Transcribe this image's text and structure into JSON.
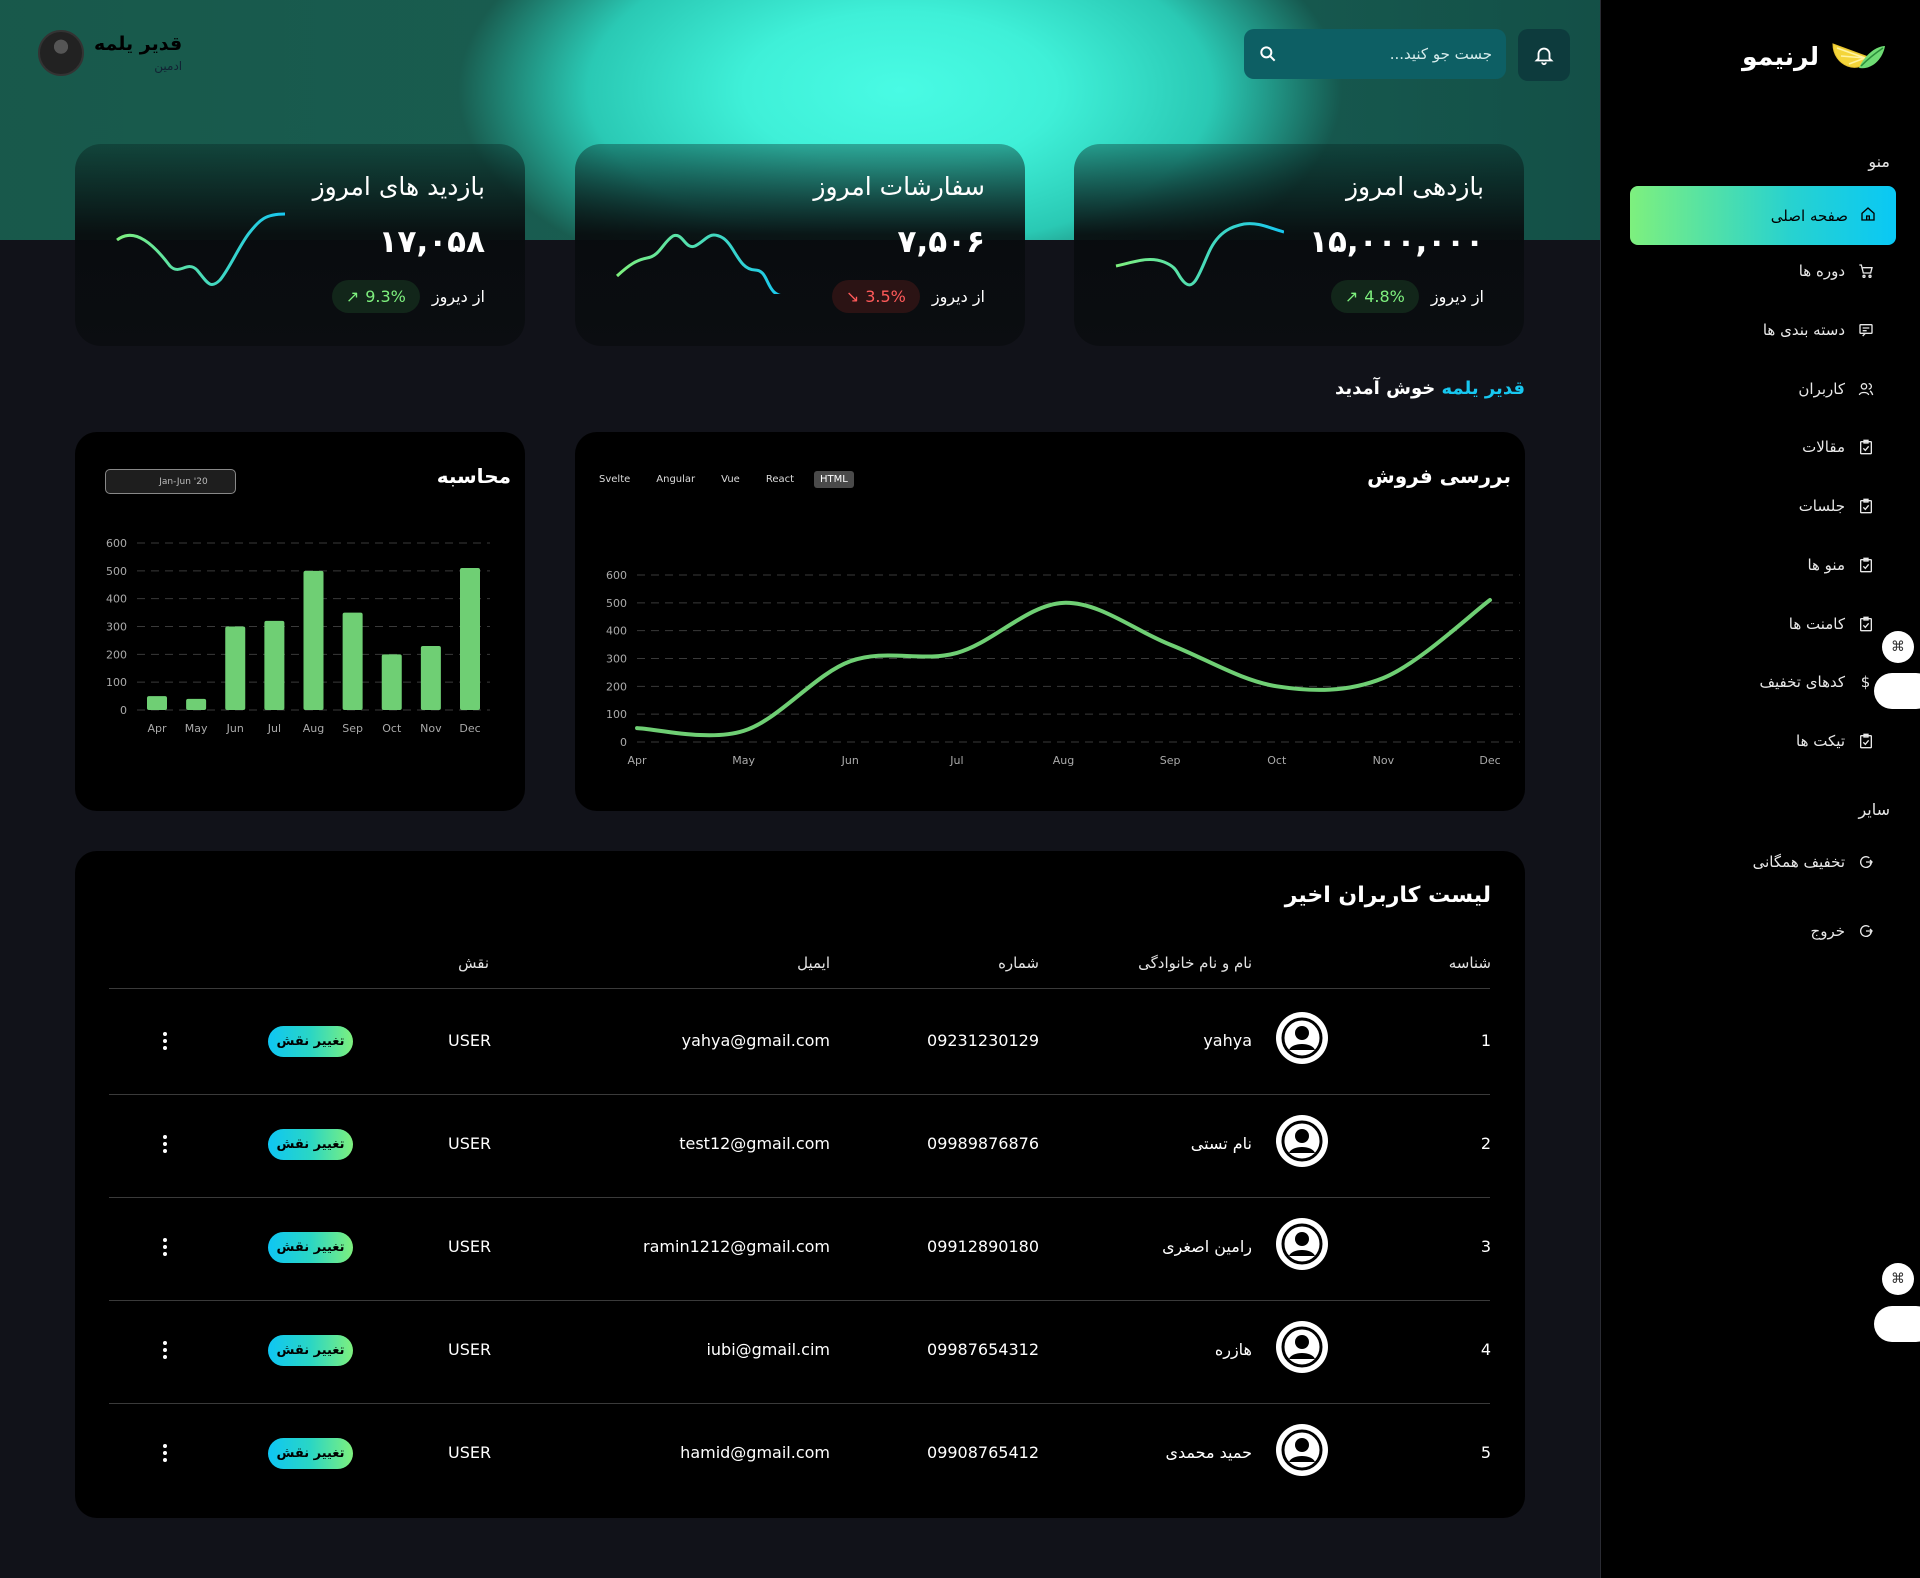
{
  "brand": {
    "name": "لرنیمو"
  },
  "sidebar": {
    "menu_label": "منو",
    "other_label": "سایر",
    "items": [
      {
        "label": "صفحه اصلی",
        "icon": "home-icon"
      },
      {
        "label": "دوره ها",
        "icon": "cart-icon"
      },
      {
        "label": "دسته بندی ها",
        "icon": "message-icon"
      },
      {
        "label": "کاربران",
        "icon": "users-icon"
      },
      {
        "label": "مقالات",
        "icon": "clipboard-icon"
      },
      {
        "label": "جلسات",
        "icon": "clipboard-icon"
      },
      {
        "label": "منو ها",
        "icon": "clipboard-icon"
      },
      {
        "label": "کامنت ها",
        "icon": "clipboard-icon"
      },
      {
        "label": "کدهای تخفیف",
        "icon": "dollar-icon"
      },
      {
        "label": "تیکت ها",
        "icon": "clipboard-icon"
      }
    ],
    "other_items": [
      {
        "label": "تخفیف همگانی",
        "icon": "logout-icon"
      },
      {
        "label": "خروج",
        "icon": "logout-icon"
      }
    ]
  },
  "header": {
    "search_placeholder": "جست جو کنید...",
    "user_name": "قدیر یلمه",
    "user_role": "ادمین"
  },
  "stats": [
    {
      "title": "بازدهی امروز",
      "value": "۱۵,۰۰۰,۰۰۰",
      "change": "4.8%",
      "direction": "up",
      "since": "از دیروز"
    },
    {
      "title": "سفارشات امروز",
      "value": "۷,۵۰۶",
      "change": "3.5%",
      "direction": "down",
      "since": "از دیروز"
    },
    {
      "title": "بازدید های امروز",
      "value": "۱۷,۰۵۸",
      "change": "9.3%",
      "direction": "up",
      "since": "از دیروز"
    }
  ],
  "welcome": {
    "name": "قدیر یلمه",
    "text": "خوش آمدید"
  },
  "sales_panel": {
    "title": "بررسی فروش",
    "tabs": [
      "Svelte",
      "Angular",
      "Vue",
      "React",
      "HTML"
    ],
    "active_tab": "HTML"
  },
  "calc_panel": {
    "title": "محاسبه",
    "date_label": "Jan-Jun '20"
  },
  "chart_data": [
    {
      "type": "line",
      "x": [
        "Apr",
        "May",
        "Jun",
        "Jul",
        "Aug",
        "Sep",
        "Oct",
        "Nov",
        "Dec"
      ],
      "series": [
        {
          "values": [
            50,
            40,
            290,
            320,
            500,
            350,
            200,
            230,
            510
          ]
        }
      ],
      "ylim": [
        0,
        600
      ],
      "yticks": [
        0,
        100,
        200,
        300,
        400,
        500,
        600
      ],
      "color": "#6fcf74",
      "grid": true
    },
    {
      "type": "bar",
      "categories": [
        "Apr",
        "May",
        "Jun",
        "Jul",
        "Aug",
        "Sep",
        "Oct",
        "Nov",
        "Dec"
      ],
      "values": [
        50,
        40,
        300,
        320,
        500,
        350,
        200,
        230,
        510
      ],
      "ylim": [
        0,
        600
      ],
      "yticks": [
        0,
        100,
        200,
        300,
        400,
        500,
        600
      ],
      "color": "#6fcf74",
      "grid": true
    }
  ],
  "users_table": {
    "title": "لیست کاربران اخیر",
    "columns": {
      "id": "شناسه",
      "name": "نام و نام خانوادگی",
      "phone": "شماره",
      "email": "ایمیل",
      "role": "نقش"
    },
    "change_role_label": "تغییر نقش",
    "rows": [
      {
        "id": "1",
        "name": "yahya",
        "phone": "09231230129",
        "email": "yahya@gmail.com",
        "role": "USER"
      },
      {
        "id": "2",
        "name": "نام تستی",
        "phone": "09989876876",
        "email": "test12@gmail.com",
        "role": "USER"
      },
      {
        "id": "3",
        "name": "رامین اصغری",
        "phone": "09912890180",
        "email": "ramin1212@gmail.com",
        "role": "USER"
      },
      {
        "id": "4",
        "name": "هازره",
        "phone": "09987654312",
        "email": "iubi@gmail.cim",
        "role": "USER"
      },
      {
        "id": "5",
        "name": "حمید محمدی",
        "phone": "09908765412",
        "email": "hamid@gmail.com",
        "role": "USER"
      }
    ]
  }
}
